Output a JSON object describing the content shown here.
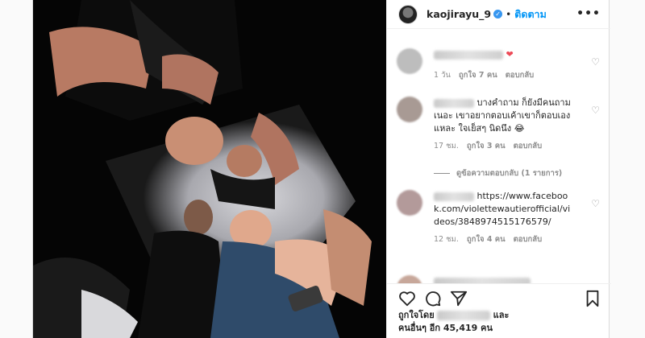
{
  "post": {
    "username": "kaojirayu_9",
    "verified_badge": "✓",
    "separator": "•",
    "follow_label": "ติดตาม",
    "more_icon": "•••"
  },
  "comments": [
    {
      "text": "",
      "emoji": "❤",
      "time": "1 วัน",
      "likes": "ถูกใจ 7 คน",
      "reply": "ตอบกลับ"
    },
    {
      "text": "บางคำถาม ก็ยังมีคนถามเนอะ เขาอยากตอบเค้าเขาก็ตอบเองแหละ ใจเย็สๆ นิดนึง",
      "emoji": "😂",
      "time": "17 ชม.",
      "likes": "ถูกใจ 3 คน",
      "reply": "ตอบกลับ",
      "view_replies": "ดูข้อความตอบกลับ (1 รายการ)"
    },
    {
      "text": "https://www.facebook.com/violettewautierofficial/videos/3848974515176579/",
      "time": "12 ชม.",
      "likes": "ถูกใจ 4 คน",
      "reply": "ตอบกลับ"
    }
  ],
  "footer": {
    "liked_by_prefix": "ถูกใจโดย",
    "liked_by_suffix": "และ",
    "others": "คนอื่นๆ อีก 45,419 คน"
  },
  "colors": {
    "accent": "#0095f6",
    "heart": "#ed4956",
    "meta": "#8e8e8e"
  },
  "icons": [
    "heart-icon",
    "comment-icon",
    "share-icon",
    "bookmark-icon",
    "more-icon",
    "verified-icon"
  ]
}
